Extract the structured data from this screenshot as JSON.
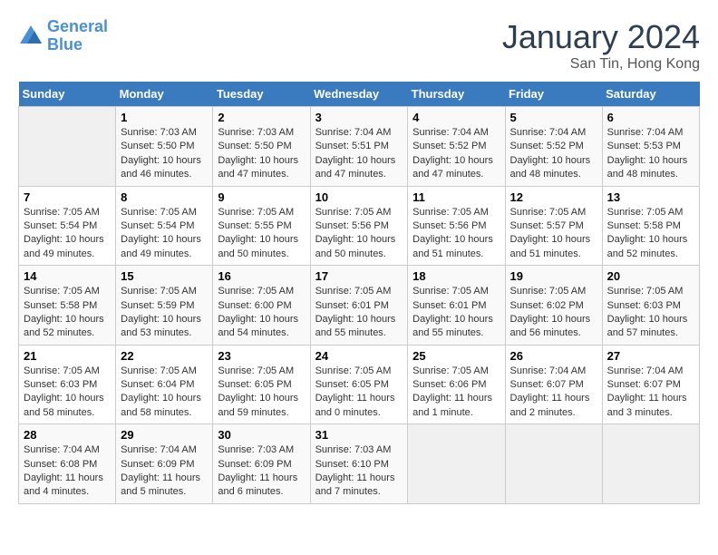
{
  "header": {
    "logo_line1": "General",
    "logo_line2": "Blue",
    "month_title": "January 2024",
    "location": "San Tin, Hong Kong"
  },
  "weekdays": [
    "Sunday",
    "Monday",
    "Tuesday",
    "Wednesday",
    "Thursday",
    "Friday",
    "Saturday"
  ],
  "weeks": [
    [
      {
        "day": "",
        "info": ""
      },
      {
        "day": "1",
        "info": "Sunrise: 7:03 AM\nSunset: 5:50 PM\nDaylight: 10 hours\nand 46 minutes."
      },
      {
        "day": "2",
        "info": "Sunrise: 7:03 AM\nSunset: 5:50 PM\nDaylight: 10 hours\nand 47 minutes."
      },
      {
        "day": "3",
        "info": "Sunrise: 7:04 AM\nSunset: 5:51 PM\nDaylight: 10 hours\nand 47 minutes."
      },
      {
        "day": "4",
        "info": "Sunrise: 7:04 AM\nSunset: 5:52 PM\nDaylight: 10 hours\nand 47 minutes."
      },
      {
        "day": "5",
        "info": "Sunrise: 7:04 AM\nSunset: 5:52 PM\nDaylight: 10 hours\nand 48 minutes."
      },
      {
        "day": "6",
        "info": "Sunrise: 7:04 AM\nSunset: 5:53 PM\nDaylight: 10 hours\nand 48 minutes."
      }
    ],
    [
      {
        "day": "7",
        "info": "Sunrise: 7:05 AM\nSunset: 5:54 PM\nDaylight: 10 hours\nand 49 minutes."
      },
      {
        "day": "8",
        "info": "Sunrise: 7:05 AM\nSunset: 5:54 PM\nDaylight: 10 hours\nand 49 minutes."
      },
      {
        "day": "9",
        "info": "Sunrise: 7:05 AM\nSunset: 5:55 PM\nDaylight: 10 hours\nand 50 minutes."
      },
      {
        "day": "10",
        "info": "Sunrise: 7:05 AM\nSunset: 5:56 PM\nDaylight: 10 hours\nand 50 minutes."
      },
      {
        "day": "11",
        "info": "Sunrise: 7:05 AM\nSunset: 5:56 PM\nDaylight: 10 hours\nand 51 minutes."
      },
      {
        "day": "12",
        "info": "Sunrise: 7:05 AM\nSunset: 5:57 PM\nDaylight: 10 hours\nand 51 minutes."
      },
      {
        "day": "13",
        "info": "Sunrise: 7:05 AM\nSunset: 5:58 PM\nDaylight: 10 hours\nand 52 minutes."
      }
    ],
    [
      {
        "day": "14",
        "info": "Sunrise: 7:05 AM\nSunset: 5:58 PM\nDaylight: 10 hours\nand 52 minutes."
      },
      {
        "day": "15",
        "info": "Sunrise: 7:05 AM\nSunset: 5:59 PM\nDaylight: 10 hours\nand 53 minutes."
      },
      {
        "day": "16",
        "info": "Sunrise: 7:05 AM\nSunset: 6:00 PM\nDaylight: 10 hours\nand 54 minutes."
      },
      {
        "day": "17",
        "info": "Sunrise: 7:05 AM\nSunset: 6:01 PM\nDaylight: 10 hours\nand 55 minutes."
      },
      {
        "day": "18",
        "info": "Sunrise: 7:05 AM\nSunset: 6:01 PM\nDaylight: 10 hours\nand 55 minutes."
      },
      {
        "day": "19",
        "info": "Sunrise: 7:05 AM\nSunset: 6:02 PM\nDaylight: 10 hours\nand 56 minutes."
      },
      {
        "day": "20",
        "info": "Sunrise: 7:05 AM\nSunset: 6:03 PM\nDaylight: 10 hours\nand 57 minutes."
      }
    ],
    [
      {
        "day": "21",
        "info": "Sunrise: 7:05 AM\nSunset: 6:03 PM\nDaylight: 10 hours\nand 58 minutes."
      },
      {
        "day": "22",
        "info": "Sunrise: 7:05 AM\nSunset: 6:04 PM\nDaylight: 10 hours\nand 58 minutes."
      },
      {
        "day": "23",
        "info": "Sunrise: 7:05 AM\nSunset: 6:05 PM\nDaylight: 10 hours\nand 59 minutes."
      },
      {
        "day": "24",
        "info": "Sunrise: 7:05 AM\nSunset: 6:05 PM\nDaylight: 11 hours\nand 0 minutes."
      },
      {
        "day": "25",
        "info": "Sunrise: 7:05 AM\nSunset: 6:06 PM\nDaylight: 11 hours\nand 1 minute."
      },
      {
        "day": "26",
        "info": "Sunrise: 7:04 AM\nSunset: 6:07 PM\nDaylight: 11 hours\nand 2 minutes."
      },
      {
        "day": "27",
        "info": "Sunrise: 7:04 AM\nSunset: 6:07 PM\nDaylight: 11 hours\nand 3 minutes."
      }
    ],
    [
      {
        "day": "28",
        "info": "Sunrise: 7:04 AM\nSunset: 6:08 PM\nDaylight: 11 hours\nand 4 minutes."
      },
      {
        "day": "29",
        "info": "Sunrise: 7:04 AM\nSunset: 6:09 PM\nDaylight: 11 hours\nand 5 minutes."
      },
      {
        "day": "30",
        "info": "Sunrise: 7:03 AM\nSunset: 6:09 PM\nDaylight: 11 hours\nand 6 minutes."
      },
      {
        "day": "31",
        "info": "Sunrise: 7:03 AM\nSunset: 6:10 PM\nDaylight: 11 hours\nand 7 minutes."
      },
      {
        "day": "",
        "info": ""
      },
      {
        "day": "",
        "info": ""
      },
      {
        "day": "",
        "info": ""
      }
    ]
  ]
}
